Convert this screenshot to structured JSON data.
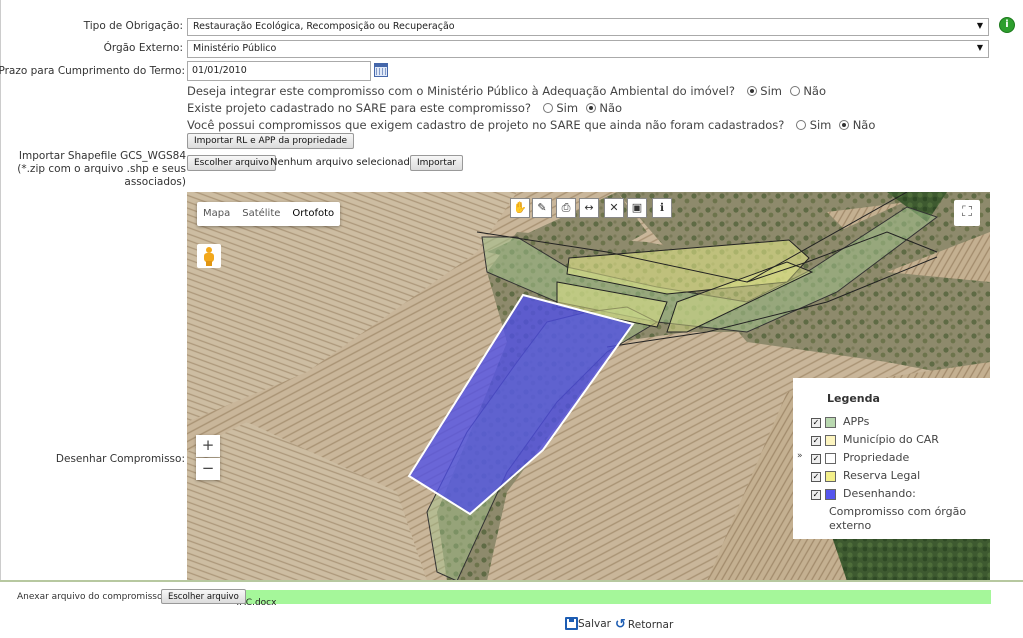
{
  "form": {
    "tipo_label": "Tipo de Obrigação:",
    "tipo_value": "Restauração Ecológica, Recomposição ou Recuperação",
    "orgao_label": "Órgão Externo:",
    "orgao_value": "Ministério Público",
    "prazo_label": "Prazo para Cumprimento do Termo:",
    "prazo_value": "01/01/2010",
    "q1": "Deseja integrar este compromisso com o Ministério Público à Adequação Ambiental do imóvel?",
    "q2": "Existe projeto cadastrado no SARE para este compromisso?",
    "q3": "Você possui compromissos que exigem cadastro de projeto no SARE que ainda não foram cadastrados?",
    "sim": "Sim",
    "nao": "Não",
    "import_rl_btn": "Importar RL e APP da propriedade",
    "shapefile_label_1": "Importar Shapefile GCS_WGS84",
    "shapefile_label_2": "(*.zip com o arquivo .shp e seus",
    "shapefile_label_3": "associados)",
    "choose_file_btn": "Escolher arquivo",
    "no_file": "Nenhum arquivo selecionado",
    "import_btn": "Importar",
    "desenhar_label": "Desenhar Compromisso:"
  },
  "map": {
    "types": [
      "Mapa",
      "Satélite",
      "Ortofoto"
    ],
    "active_type": "Ortofoto",
    "legend_title": "Legenda",
    "legend": [
      {
        "label": "APPs",
        "color": "#b9d8b0"
      },
      {
        "label": "Município do CAR",
        "color": "#fdf5c0"
      },
      {
        "label": "Propriedade",
        "color": "#ffffff"
      },
      {
        "label": "Reserva Legal",
        "color": "#f4f08a"
      },
      {
        "label": "Desenhando:",
        "color": "#5555ee"
      }
    ],
    "legend_extra_1": "Compromisso com órgão",
    "legend_extra_2": "externo",
    "zoom_in": "+",
    "zoom_out": "−"
  },
  "footer": {
    "anexar_label": "Anexar arquivo do compromisso:",
    "choose_file_btn": "Escolher arquivo",
    "file_name": "TAC.docx",
    "salvar": "Salvar",
    "retornar": "Retornar"
  },
  "colors": {
    "ok_icon": "#2e9e2e",
    "file_bar": "#a5f79a",
    "drawing": "#5050e8"
  }
}
